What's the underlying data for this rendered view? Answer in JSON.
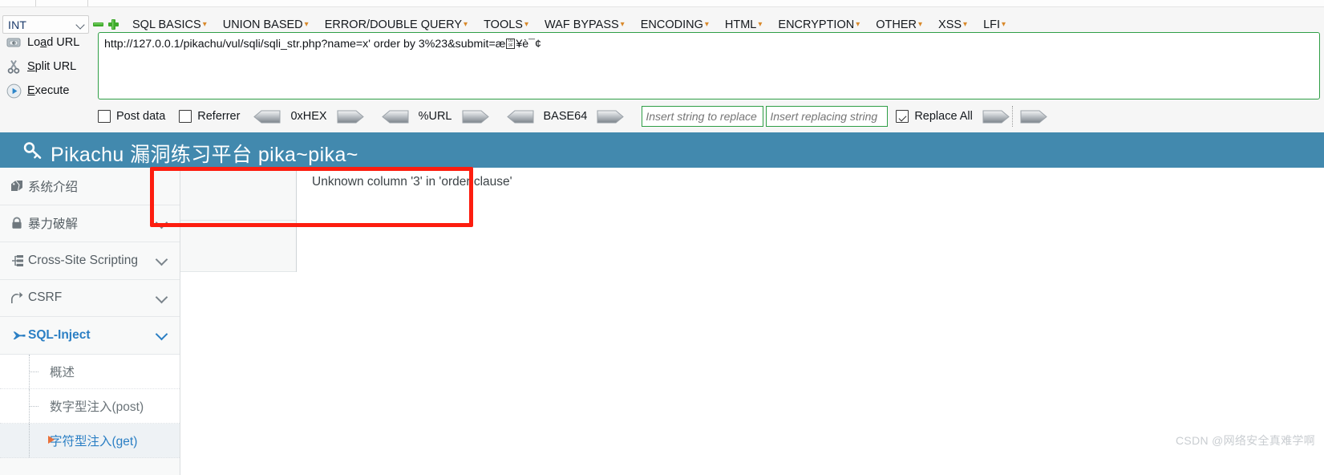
{
  "hackbar": {
    "mode_select": {
      "value": "INT",
      "icon": "chevron-down-icon"
    },
    "buttons": {
      "minus": "remove-row-icon",
      "plus": "add-row-icon"
    },
    "menu": [
      {
        "label": "SQL BASICS",
        "caret": "▾"
      },
      {
        "label": "UNION BASED",
        "caret": "▾"
      },
      {
        "label": "ERROR/DOUBLE QUERY",
        "caret": "▾"
      },
      {
        "label": "TOOLS",
        "caret": "▾"
      },
      {
        "label": "WAF BYPASS",
        "caret": "▾"
      },
      {
        "label": "ENCODING",
        "caret": "▾"
      },
      {
        "label": "HTML",
        "caret": "▾"
      },
      {
        "label": "ENCRYPTION",
        "caret": "▾"
      },
      {
        "label": "OTHER",
        "caret": "▾"
      },
      {
        "label": "XSS",
        "caret": "▾"
      },
      {
        "label": "LFI",
        "caret": "▾"
      }
    ],
    "actions": [
      {
        "label_pre": "Lo",
        "label_key": "a",
        "label_post": "d URL",
        "icon": "load-url-icon"
      },
      {
        "label_pre": "",
        "label_key": "S",
        "label_post": "plit URL",
        "icon": "scissors-icon"
      },
      {
        "label_pre": "",
        "label_key": "E",
        "label_post": "xecute",
        "icon": "play-icon"
      }
    ],
    "url_field": {
      "text_head": "http://127.0.0.1/pikachu/vul/sqli/sqli_str.php?name=x' order by 3%23&submit=",
      "text_mojibake": "æ",
      "text_tail": "¥è¯¢",
      "border_color": "#2f9e46"
    },
    "options": {
      "post_data": {
        "label": "Post data",
        "checked": false
      },
      "referrer": {
        "label": "Referrer",
        "checked": false
      },
      "replace_all": {
        "label": "Replace All",
        "checked": true
      }
    },
    "encoders": [
      {
        "label": "0xHEX"
      },
      {
        "label": "%URL"
      },
      {
        "label": "BASE64"
      }
    ],
    "replace_inputs": [
      {
        "placeholder": "Insert string to replace",
        "value": ""
      },
      {
        "placeholder": "Insert replacing string",
        "value": ""
      }
    ]
  },
  "pikachu": {
    "header": {
      "title": "Pikachu 漏洞练习平台 pika~pika~",
      "icon": "key-icon",
      "bg_color": "#4289ae"
    },
    "sidebar": [
      {
        "label": "系统介绍",
        "icon": "tag-icon",
        "chevron": false,
        "active": false
      },
      {
        "label": "暴力破解",
        "icon": "lock-icon",
        "chevron": true,
        "active": false
      },
      {
        "label": "Cross-Site Scripting",
        "icon": "sitemap-icon",
        "chevron": true,
        "active": false
      },
      {
        "label": "CSRF",
        "icon": "share-icon",
        "chevron": true,
        "active": false
      },
      {
        "label": "SQL-Inject",
        "icon": "plane-icon",
        "chevron": true,
        "active": true
      }
    ],
    "sidebar_sub": [
      {
        "label": "概述",
        "current": false
      },
      {
        "label": "数字型注入(post)",
        "current": false
      },
      {
        "label": "字符型注入(get)",
        "current": true
      }
    ],
    "content": {
      "error_message": "Unknown column '3' in 'order clause'"
    },
    "annotation": {
      "color": "#fd1d0f",
      "shape": "rectangle"
    }
  },
  "watermark": {
    "text": "CSDN @网络安全真难学啊"
  }
}
